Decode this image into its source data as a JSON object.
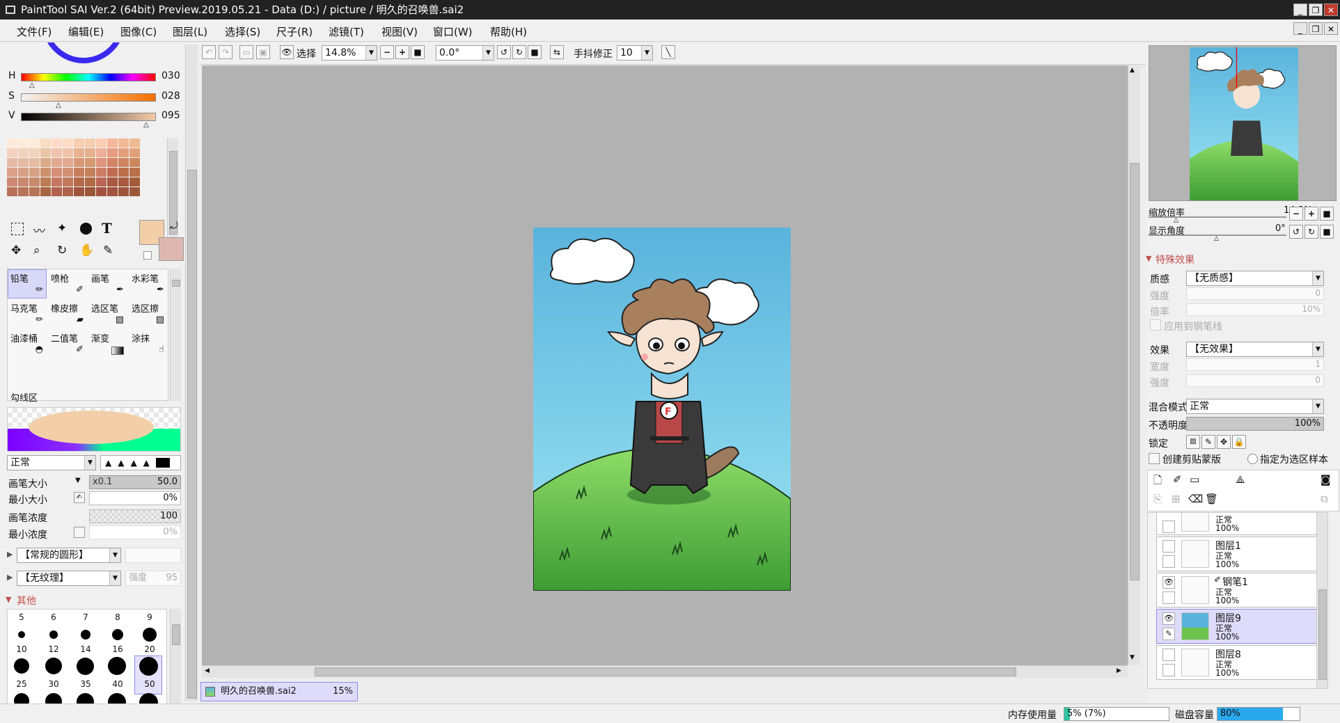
{
  "window": {
    "title": "PaintTool SAI Ver.2 (64bit) Preview.2019.05.21 - Data (D:) / picture / 明久的召唤兽.sai2"
  },
  "menu": [
    "文件(F)",
    "编辑(E)",
    "图像(C)",
    "图层(L)",
    "选择(S)",
    "尺子(R)",
    "滤镜(T)",
    "视图(V)",
    "窗口(W)",
    "帮助(H)"
  ],
  "toolbar": {
    "select_label": "选择",
    "zoom": "14.8%",
    "angle": "0.0°",
    "stabilizer_label": "手抖修正",
    "stabilizer": "10"
  },
  "hsv": {
    "h_label": "H",
    "h": "030",
    "s_label": "S",
    "s": "028",
    "v_label": "V",
    "v": "095"
  },
  "tools": [
    {
      "label": "铅笔"
    },
    {
      "label": "喷枪"
    },
    {
      "label": "画笔"
    },
    {
      "label": "水彩笔"
    },
    {
      "label": "马克笔"
    },
    {
      "label": "橡皮擦"
    },
    {
      "label": "选区笔"
    },
    {
      "label": "选区擦"
    },
    {
      "label": "油漆桶"
    },
    {
      "label": "二值笔"
    },
    {
      "label": "渐变"
    },
    {
      "label": "涂抹"
    }
  ],
  "tool_group_label": "勾线区",
  "brush": {
    "mode": "正常",
    "size_label": "画笔大小",
    "size_mult": "x0.1",
    "size": "50.0",
    "min_size_label": "最小大小",
    "min_size": "0%",
    "density_label": "画笔浓度",
    "density": "100",
    "min_density_label": "最小浓度",
    "min_density": "0%",
    "shape": "【常规的圆形】",
    "texture": "【无纹理】",
    "texture_strength_label": "强度",
    "texture_strength": "95",
    "other_label": "其他"
  },
  "brush_sizes": {
    "row0": [
      "5",
      "6",
      "7",
      "8",
      "9"
    ],
    "row1": [
      "10",
      "12",
      "14",
      "16",
      "20"
    ],
    "row2": [
      "25",
      "30",
      "35",
      "40",
      "50"
    ]
  },
  "document_tab": {
    "name": "明久的召唤兽.sai2",
    "zoom": "15%"
  },
  "navigator": {
    "zoom_label": "缩放倍率",
    "zoom": "14.8%",
    "angle_label": "显示角度",
    "angle": "0°"
  },
  "effects": {
    "title": "特殊效果",
    "texture_label": "质感",
    "texture": "【无质感】",
    "strength_label": "强度",
    "strength": "0",
    "scale_label": "倍率",
    "scale": "10%",
    "apply_pen_label": "应用到钢笔线",
    "effect_label": "效果",
    "effect": "【无效果】",
    "width_label": "宽度",
    "width": "1",
    "strength2_label": "强度",
    "strength2": "0"
  },
  "layer_props": {
    "blend_label": "混合模式",
    "blend": "正常",
    "opacity_label": "不透明度",
    "opacity": "100%",
    "lock_label": "锁定",
    "clip_label": "创建剪贴蒙版",
    "selsrc_label": "指定为选区样本"
  },
  "layers": [
    {
      "name": "",
      "mode": "正常",
      "opacity": "100%"
    },
    {
      "name": "图层1",
      "mode": "正常",
      "opacity": "100%"
    },
    {
      "name": "钢笔1",
      "mode": "正常",
      "opacity": "100%"
    },
    {
      "name": "图层9",
      "mode": "正常",
      "opacity": "100%"
    },
    {
      "name": "图层8",
      "mode": "正常",
      "opacity": "100%"
    }
  ],
  "status": {
    "mem_label": "内存使用量",
    "mem": "5% (7%)",
    "mem_fill": 0.05,
    "disk_label": "磁盘容量",
    "disk": "80%",
    "disk_fill": 0.8
  },
  "colors": {
    "accent": "#c0504d",
    "selection": "#dedcfa",
    "current_color": "#f2cfa8"
  }
}
